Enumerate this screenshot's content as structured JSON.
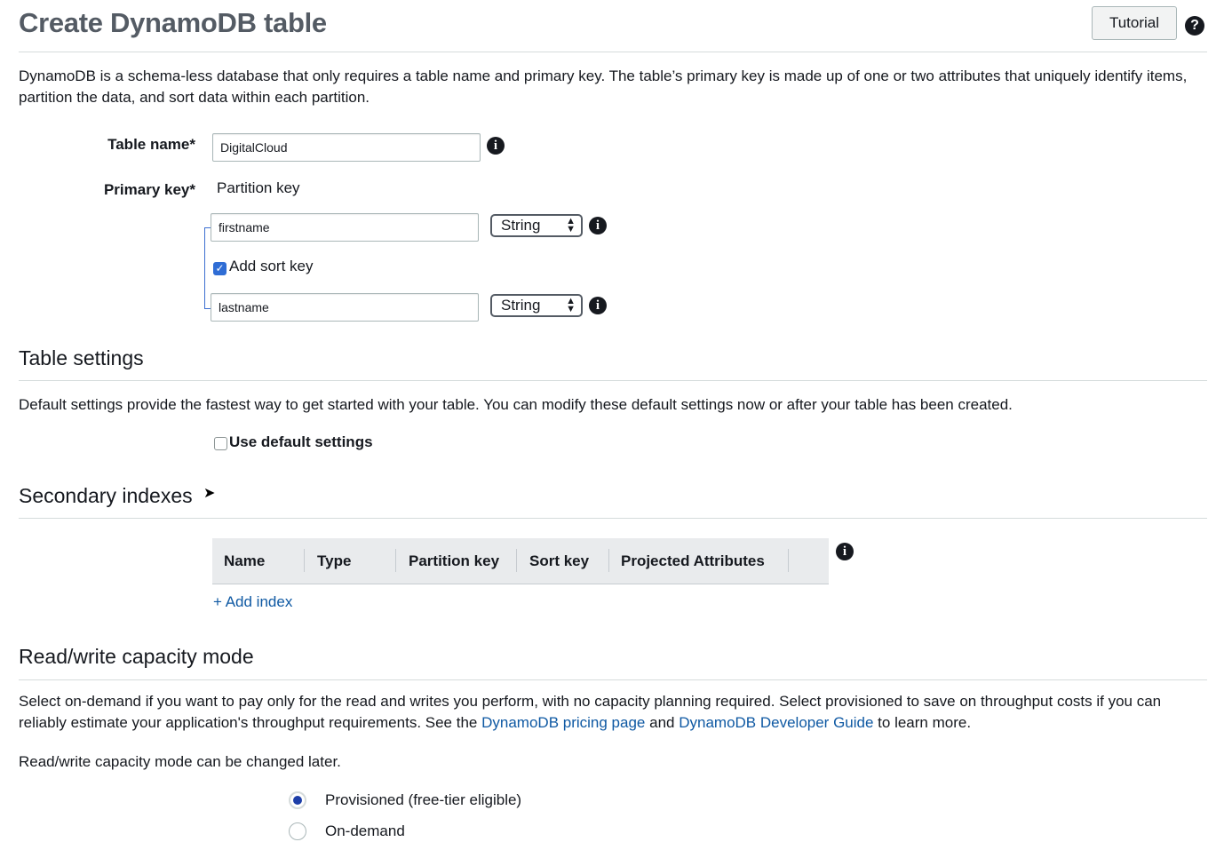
{
  "header": {
    "title": "Create DynamoDB table",
    "tutorial_label": "Tutorial",
    "help_icon": "question-circle-icon"
  },
  "intro": {
    "text": "DynamoDB is a schema-less database that only requires a table name and primary key. The table’s primary key is made up of one or two attributes that uniquely identify items, partition the data, and sort data within each partition."
  },
  "table_name": {
    "label": "Table name*",
    "value": "DigitalCloud"
  },
  "primary_key": {
    "label": "Primary key*",
    "partition_heading": "Partition key",
    "partition_value": "firstname",
    "partition_type": "String",
    "add_sort_key_label": "Add sort key",
    "add_sort_key_checked": true,
    "sort_value": "lastname",
    "sort_type": "String"
  },
  "table_settings": {
    "heading": "Table settings",
    "text": "Default settings provide the fastest way to get started with your table. You can modify these default settings now or after your table has been created.",
    "use_default_label": "Use default settings",
    "use_default_checked": false
  },
  "secondary_indexes": {
    "heading": "Secondary indexes",
    "columns": [
      "Name",
      "Type",
      "Partition key",
      "Sort key",
      "Projected Attributes"
    ],
    "add_index_label": "+ Add index"
  },
  "capacity": {
    "heading": "Read/write capacity mode",
    "text_before": "Select on-demand if you want to pay only for the read and writes you perform, with no capacity planning required. Select provisioned to save on throughput costs if you can reliably estimate your application's throughput requirements. See the",
    "pricing_link": "DynamoDB pricing page",
    "and": "and",
    "guide_link": "DynamoDB Developer Guide",
    "text_after": "to learn more.",
    "change_note": "Read/write capacity mode can be changed later.",
    "options": [
      {
        "label": "Provisioned (free-tier eligible)",
        "selected": true
      },
      {
        "label": "On-demand",
        "selected": false
      }
    ]
  },
  "colors": {
    "link": "#0f59a3",
    "checkbox_on": "#2f6dd5",
    "radio_on": "#1d3ea8"
  }
}
